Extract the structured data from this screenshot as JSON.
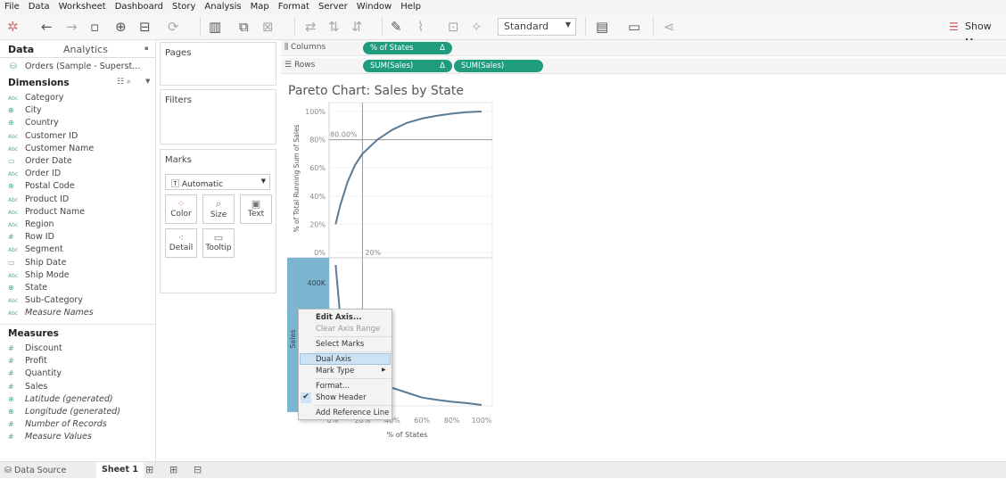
{
  "menubar": [
    "File",
    "Data",
    "Worksheet",
    "Dashboard",
    "Story",
    "Analysis",
    "Map",
    "Format",
    "Server",
    "Window",
    "Help"
  ],
  "toolbar": {
    "fit": "Standard",
    "show_me": "Show Me"
  },
  "left": {
    "tabs": [
      "Data",
      "Analytics"
    ],
    "datasource": "Orders (Sample - Superst...",
    "dimensions_label": "Dimensions",
    "dimensions": [
      [
        "Abc",
        "Category"
      ],
      [
        "geo",
        "City"
      ],
      [
        "geo",
        "Country"
      ],
      [
        "Abc",
        "Customer ID"
      ],
      [
        "Abc",
        "Customer Name"
      ],
      [
        "date",
        "Order Date"
      ],
      [
        "Abc",
        "Order ID"
      ],
      [
        "geo",
        "Postal Code"
      ],
      [
        "Abc",
        "Product ID"
      ],
      [
        "Abc",
        "Product Name"
      ],
      [
        "Abc",
        "Region"
      ],
      [
        "#",
        "Row ID"
      ],
      [
        "Abc",
        "Segment"
      ],
      [
        "date",
        "Ship Date"
      ],
      [
        "Abc",
        "Ship Mode"
      ],
      [
        "geo",
        "State"
      ],
      [
        "Abc",
        "Sub-Category"
      ],
      [
        "Abc",
        "Measure Names"
      ]
    ],
    "measures_label": "Measures",
    "measures": [
      [
        "#",
        "Discount"
      ],
      [
        "#",
        "Profit"
      ],
      [
        "#",
        "Quantity"
      ],
      [
        "#",
        "Sales"
      ],
      [
        "geo",
        "Latitude (generated)"
      ],
      [
        "geo",
        "Longitude (generated)"
      ],
      [
        "#",
        "Number of Records"
      ],
      [
        "#",
        "Measure Values"
      ]
    ]
  },
  "cards": {
    "pages": "Pages",
    "filters": "Filters",
    "marks": "Marks",
    "mark_type": "Automatic",
    "buttons": [
      "Color",
      "Size",
      "Text",
      "Detail",
      "Tooltip"
    ]
  },
  "shelves": {
    "columns": "Columns",
    "rows": "Rows",
    "col_pill": "% of States",
    "row_pills": [
      "SUM(Sales)",
      "SUM(Sales)"
    ],
    "delta": "Δ"
  },
  "chart_data": {
    "type": "line",
    "title": "Pareto Chart: Sales by State",
    "xlabel": "% of States",
    "x_ticks": [
      "0%",
      "20%",
      "40%",
      "60%",
      "80%",
      "100%"
    ],
    "xlim": [
      0,
      100
    ],
    "top": {
      "ylabel": "% of Total Running Sum of Sales",
      "ylim": [
        0,
        100
      ],
      "y_ticks": [
        "0%",
        "20%",
        "40%",
        "60%",
        "80%",
        "100%"
      ],
      "x": [
        2,
        5,
        10,
        15,
        20,
        30,
        40,
        50,
        60,
        70,
        80,
        90,
        100
      ],
      "y": [
        20,
        33,
        50,
        62,
        70,
        80,
        87,
        92,
        95,
        97,
        98.5,
        99.5,
        100
      ],
      "ref_lines": {
        "y": 80,
        "y_label": "80.00%",
        "x": 20,
        "x_label": "20%"
      }
    },
    "bottom": {
      "ylabel": "Sales",
      "y_ticks": [
        "400K"
      ],
      "ylim": [
        0,
        480
      ],
      "x": [
        2,
        5,
        10,
        15,
        20,
        30,
        40,
        50,
        60,
        70,
        80,
        90,
        100
      ],
      "y": [
        455,
        300,
        200,
        150,
        120,
        90,
        75,
        60,
        45,
        38,
        32,
        28,
        22
      ]
    },
    "line_color": "#5b7a93"
  },
  "context_menu": [
    "Edit Axis...",
    "Clear Axis Range",
    "Select Marks",
    "Dual Axis",
    "Mark Type",
    "Format...",
    "Show Header",
    "Add Reference Line"
  ],
  "bottom_bar": {
    "data_source": "Data Source",
    "sheet": "Sheet 1"
  }
}
